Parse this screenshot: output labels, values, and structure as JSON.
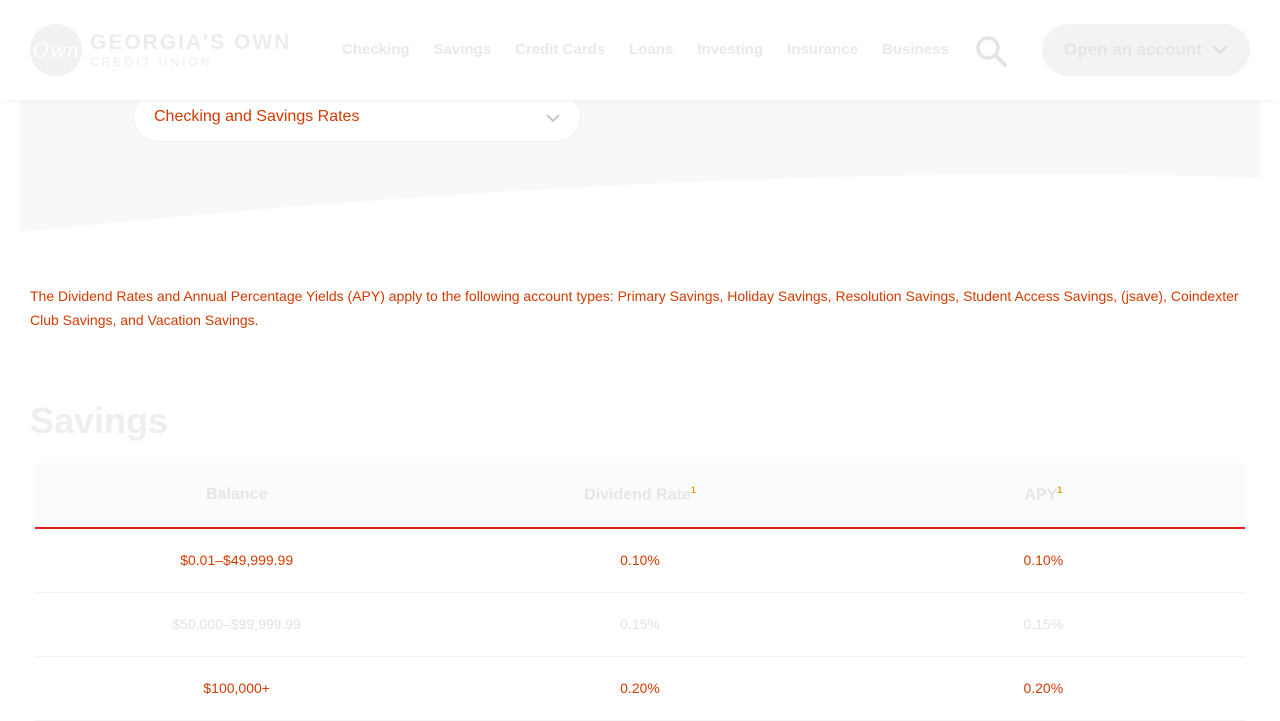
{
  "brand": {
    "logo_mark": "Own",
    "name_line1": "GEORGIA'S OWN",
    "name_line2": "CREDIT UNION"
  },
  "nav": {
    "items": [
      "Checking",
      "Savings",
      "Credit Cards",
      "Loans",
      "Investing",
      "Insurance",
      "Business"
    ],
    "search_icon": "search-icon",
    "open_account_label": "Open an account"
  },
  "rate_selector": {
    "value": "Checking and Savings Rates"
  },
  "intro": {
    "text": "The Dividend Rates and Annual Percentage Yields (APY) apply to the following account types: Primary Savings, Holiday Savings, Resolution Savings, Student Access Savings, (jsave), Coindexter Club Savings, and Vacation Savings."
  },
  "savings": {
    "title": "Savings",
    "columns": [
      "Balance",
      "Dividend Rate",
      "APY"
    ],
    "footnote_mark": "1",
    "rows": [
      [
        "$0.01–$49,999.99",
        "0.10%",
        "0.10%"
      ],
      [
        "$50,000–$99,999.99",
        "0.15%",
        "0.15%"
      ],
      [
        "$100,000+",
        "0.20%",
        "0.20%"
      ]
    ]
  },
  "colors": {
    "accent_red": "#e21b1b",
    "text_highlight": "#d43a00",
    "footnote": "#e8a200"
  }
}
